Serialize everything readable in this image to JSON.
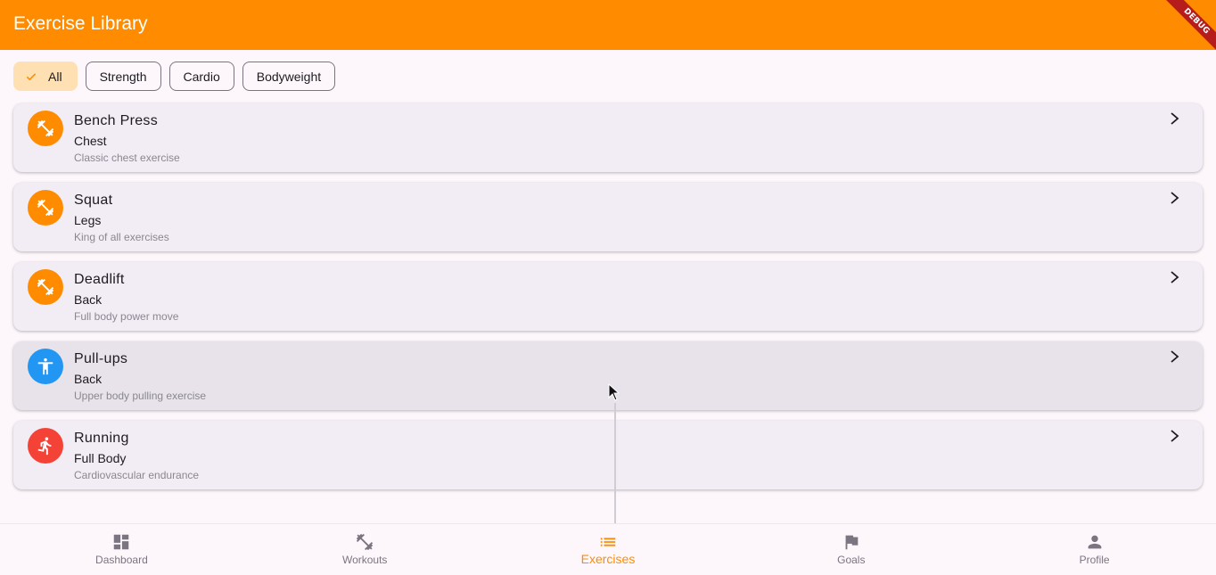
{
  "app_bar": {
    "title": "Exercise Library",
    "debug_label": "DEBUG"
  },
  "filters": [
    {
      "label": "All",
      "selected": true
    },
    {
      "label": "Strength",
      "selected": false
    },
    {
      "label": "Cardio",
      "selected": false
    },
    {
      "label": "Bodyweight",
      "selected": false
    }
  ],
  "exercises": [
    {
      "name": "Bench Press",
      "muscle": "Chest",
      "description": "Classic chest exercise",
      "icon": "fitness-center-icon",
      "color": "#ff8c00"
    },
    {
      "name": "Squat",
      "muscle": "Legs",
      "description": "King of all exercises",
      "icon": "fitness-center-icon",
      "color": "#ff8c00"
    },
    {
      "name": "Deadlift",
      "muscle": "Back",
      "description": "Full body power move",
      "icon": "fitness-center-icon",
      "color": "#ff8c00"
    },
    {
      "name": "Pull-ups",
      "muscle": "Back",
      "description": "Upper body pulling exercise",
      "icon": "accessibility-icon",
      "color": "#2196f3"
    },
    {
      "name": "Running",
      "muscle": "Full Body",
      "description": "Cardiovascular endurance",
      "icon": "running-icon",
      "color": "#f44336"
    }
  ],
  "bottom_nav": [
    {
      "label": "Dashboard",
      "icon": "dashboard-icon",
      "active": false
    },
    {
      "label": "Workouts",
      "icon": "fitness-center-icon",
      "active": false
    },
    {
      "label": "Exercises",
      "icon": "list-icon",
      "active": true
    },
    {
      "label": "Goals",
      "icon": "flag-icon",
      "active": false
    },
    {
      "label": "Profile",
      "icon": "person-icon",
      "active": false
    }
  ],
  "colors": {
    "primary": "#ff8c00",
    "chip_selected": "#ffe0b2",
    "inactive": "#7a7580"
  }
}
